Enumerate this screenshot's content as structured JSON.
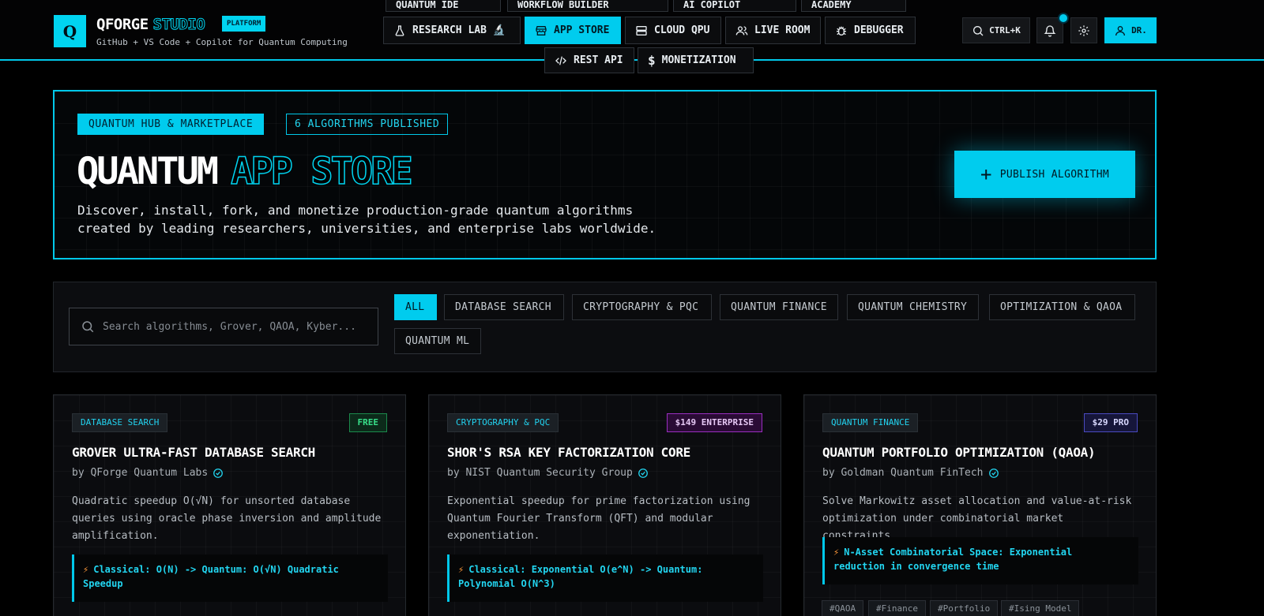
{
  "header": {
    "logo_letter": "Q",
    "brand_name": "QFORGE",
    "brand_suffix": "STUDIO",
    "brand_badge": "PLATFORM",
    "tagline": "GitHub + VS Code + Copilot for Quantum Computing",
    "ghost_nav": [
      "QUANTUM IDE",
      "WORKFLOW BUILDER",
      "AI COPILOT",
      "ACADEMY"
    ],
    "nav": {
      "research_lab": "RESEARCH LAB",
      "app_store": "APP STORE",
      "cloud_qpu": "CLOUD QPU",
      "live_room": "LIVE ROOM",
      "debugger": "DEBUGGER",
      "rest_api": "REST API",
      "monetization": "MONETIZATION"
    },
    "search_shortcut": "CTRL+K",
    "user_label": "DR."
  },
  "hero": {
    "pill_primary": "QUANTUM HUB & MARKETPLACE",
    "pill_secondary": "6 ALGORITHMS PUBLISHED",
    "title_main": "QUANTUM",
    "title_accent": "APP STORE",
    "description": "Discover, install, fork, and monetize production-grade quantum algorithms created by leading researchers, universities, and enterprise labs worldwide.",
    "publish_label": "PUBLISH ALGORITHM"
  },
  "filters": {
    "search_placeholder": "Search algorithms, Grover, QAOA, Kyber...",
    "categories": [
      "ALL",
      "DATABASE SEARCH",
      "CRYPTOGRAPHY & PQC",
      "QUANTUM FINANCE",
      "QUANTUM CHEMISTRY",
      "OPTIMIZATION & QAOA",
      "QUANTUM ML"
    ],
    "selected": "ALL"
  },
  "cards": [
    {
      "category": "DATABASE SEARCH",
      "price": "FREE",
      "title": "GROVER ULTRA-FAST DATABASE SEARCH",
      "author": "by QForge Quantum Labs",
      "description": "Quadratic speedup O(√N) for unsorted database queries using oracle phase inversion and amplitude amplification.",
      "speedup": "Classical: O(N) -> Quantum: O(√N) Quadratic Speedup"
    },
    {
      "category": "CRYPTOGRAPHY & PQC",
      "price": "$149 ENTERPRISE",
      "title": "SHOR'S RSA KEY FACTORIZATION CORE",
      "author": "by NIST Quantum Security Group",
      "description": "Exponential speedup for prime factorization using Quantum Fourier Transform (QFT) and modular exponentiation.",
      "speedup": "Classical: Exponential O(e^N) -> Quantum: Polynomial O(N^3)"
    },
    {
      "category": "QUANTUM FINANCE",
      "price": "$29 PRO",
      "title": "QUANTUM PORTFOLIO OPTIMIZATION (QAOA)",
      "author": "by Goldman Quantum FinTech",
      "description": "Solve Markowitz asset allocation and value-at-risk optimization under combinatorial market constraints.",
      "speedup": "N-Asset Combinatorial Space: Exponential reduction in convergence time",
      "tags": [
        "#QAOA",
        "#Finance",
        "#Portfolio",
        "#Ising Model"
      ]
    }
  ],
  "colors": {
    "accent": "#00ccee",
    "background": "#000000",
    "free": "#38e08a",
    "enterprise": "#9a2ec0",
    "pro": "#4a4ac0"
  }
}
